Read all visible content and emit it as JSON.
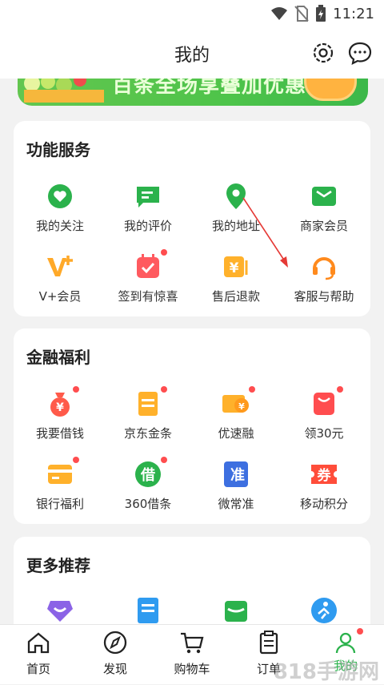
{
  "status_bar": {
    "time": "11:21"
  },
  "header": {
    "title": "我的"
  },
  "banner": {
    "text": "百条全场享叠加优惠"
  },
  "services": {
    "title": "功能服务",
    "items": [
      {
        "label": "我的关注",
        "icon": "heart-icon"
      },
      {
        "label": "我的评价",
        "icon": "comment-icon"
      },
      {
        "label": "我的地址",
        "icon": "location-icon"
      },
      {
        "label": "商家会员",
        "icon": "wallet-icon"
      },
      {
        "label": "V+会员",
        "icon": "vplus-icon"
      },
      {
        "label": "签到有惊喜",
        "icon": "calendar-icon"
      },
      {
        "label": "售后退款",
        "icon": "refund-icon"
      },
      {
        "label": "客服与帮助",
        "icon": "headset-icon"
      }
    ]
  },
  "finance": {
    "title": "金融福利",
    "items": [
      {
        "label": "我要借钱",
        "icon": "money-bag-icon"
      },
      {
        "label": "京东金条",
        "icon": "gold-bar-icon"
      },
      {
        "label": "优速融",
        "icon": "card-coin-icon"
      },
      {
        "label": "领30元",
        "icon": "red-bag-icon"
      },
      {
        "label": "银行福利",
        "icon": "bank-card-icon"
      },
      {
        "label": "360借条",
        "icon": "borrow-icon",
        "glyph": "借"
      },
      {
        "label": "微常准",
        "icon": "weichangzhun-icon",
        "glyph": "准"
      },
      {
        "label": "移动积分",
        "icon": "coupon-icon",
        "glyph": "券"
      }
    ]
  },
  "more": {
    "title": "更多推荐"
  },
  "tabs": [
    {
      "label": "首页",
      "icon": "home-icon"
    },
    {
      "label": "发现",
      "icon": "compass-icon"
    },
    {
      "label": "购物车",
      "icon": "cart-icon"
    },
    {
      "label": "订单",
      "icon": "order-icon"
    },
    {
      "label": "我的",
      "icon": "user-icon",
      "active": true
    }
  ],
  "colors": {
    "accent": "#2bb24c",
    "badge": "#ff4d4f",
    "orange": "#ff9a2e"
  },
  "watermark": "818手游网"
}
